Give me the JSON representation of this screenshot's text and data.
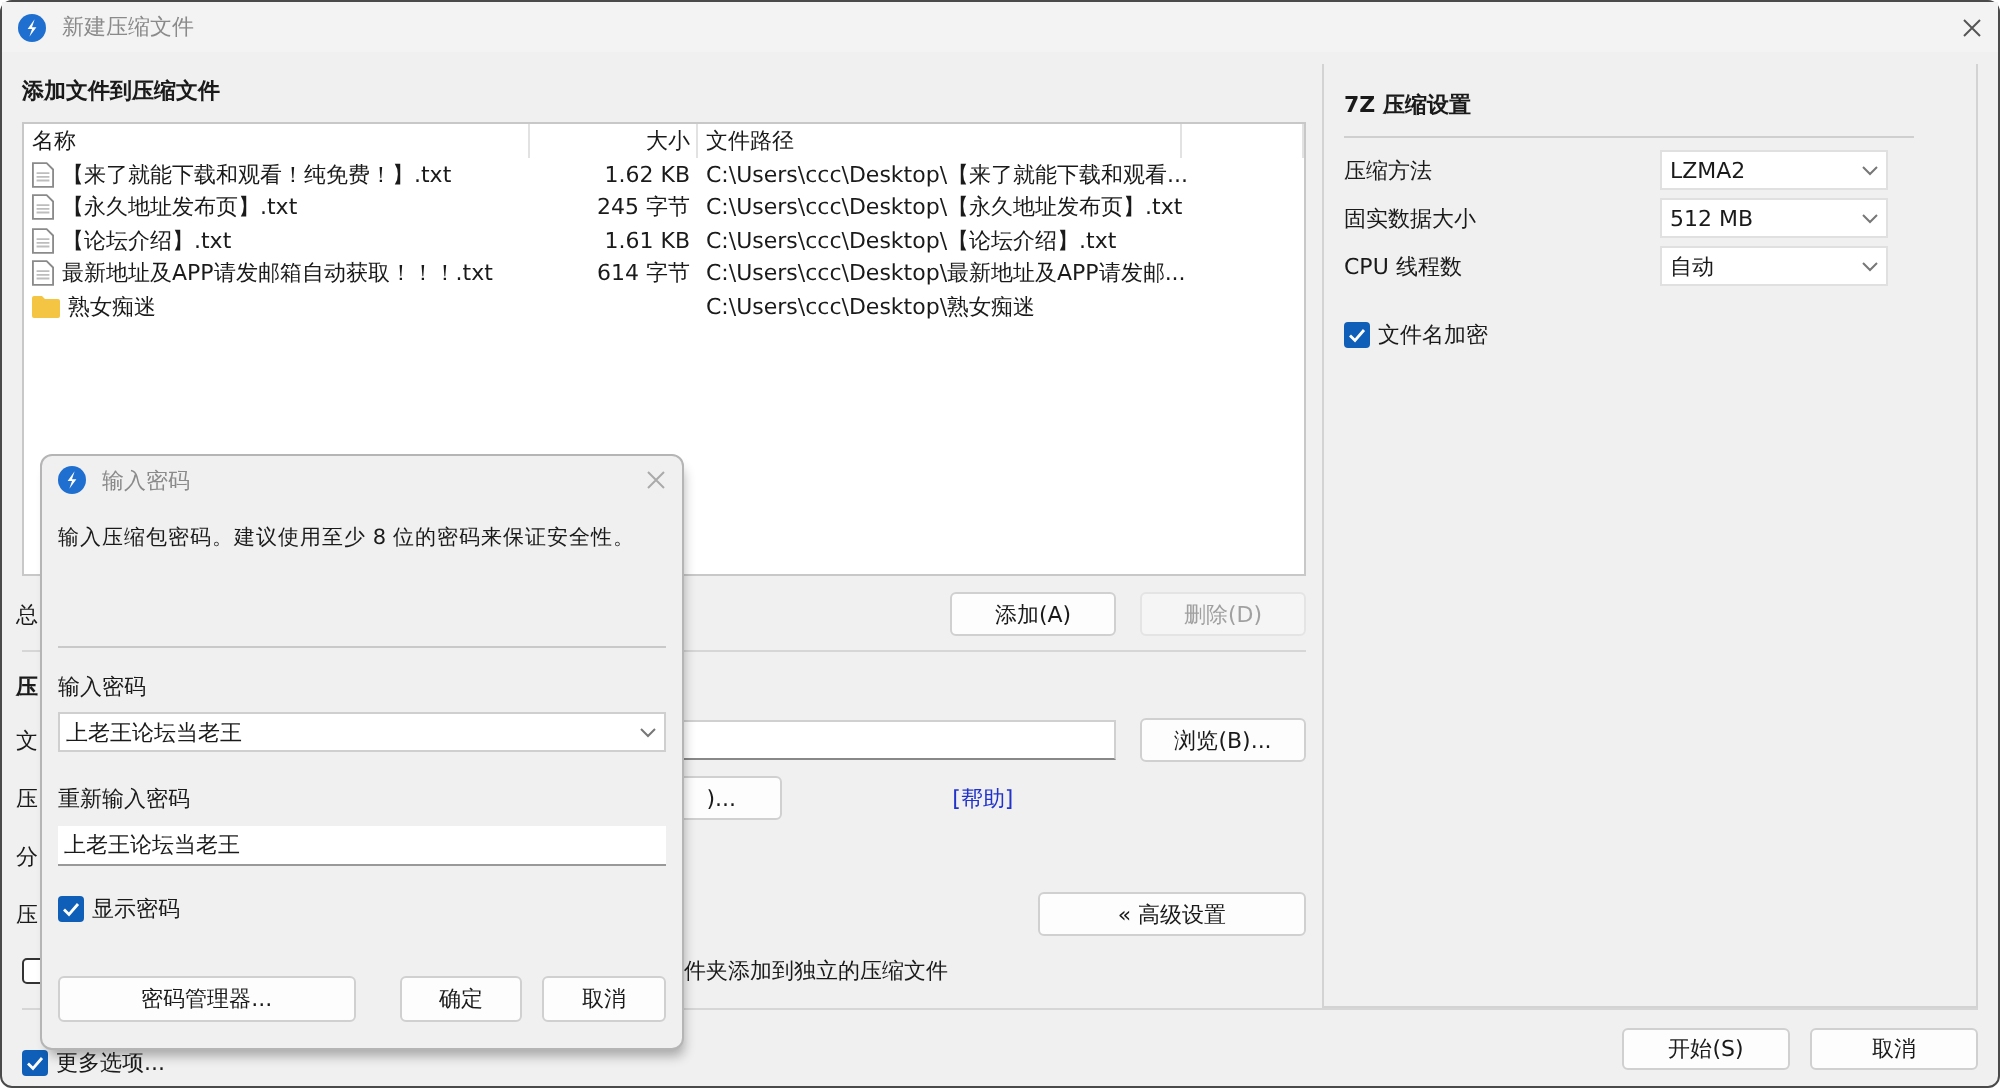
{
  "window": {
    "title": "新建压缩文件"
  },
  "files_section": {
    "heading": "添加文件到压缩文件",
    "columns": [
      "名称",
      "大小",
      "文件路径"
    ],
    "rows": [
      {
        "kind": "file",
        "name": "【来了就能下载和观看！纯免费！】.txt",
        "size": "1.62 KB",
        "path": "C:\\Users\\ccc\\Desktop\\【来了就能下载和观看..."
      },
      {
        "kind": "file",
        "name": "【永久地址发布页】.txt",
        "size": "245 字节",
        "path": "C:\\Users\\ccc\\Desktop\\【永久地址发布页】.txt"
      },
      {
        "kind": "file",
        "name": "【论坛介绍】.txt",
        "size": "1.61 KB",
        "path": "C:\\Users\\ccc\\Desktop\\【论坛介绍】.txt"
      },
      {
        "kind": "file",
        "name": "最新地址及APP请发邮箱自动获取！！！.txt",
        "size": "614 字节",
        "path": "C:\\Users\\ccc\\Desktop\\最新地址及APP请发邮..."
      },
      {
        "kind": "folder",
        "name": "熟女痴迷",
        "path": "C:\\Users\\ccc\\Desktop\\熟女痴迷"
      }
    ],
    "summary_label": "总",
    "buttons": [
      {
        "label": "添加(A)",
        "disabled": false
      },
      {
        "label": "删除(D)",
        "disabled": true
      }
    ]
  },
  "archive_section": {
    "heading": "压",
    "file_label": "文",
    "browse_button": "浏览(B)...",
    "format_label": "压",
    "password_button": ")...",
    "help_link": "[帮助]",
    "split_label": "分",
    "level_label": "压",
    "advanced_button": "« 高级设置",
    "separate_archives": {
      "label": "件夹添加到独立的压缩文件",
      "checked": false
    }
  },
  "more_options": {
    "label": "更多选项...",
    "checked": true
  },
  "settings": {
    "heading": "7Z 压缩设置",
    "fields": [
      {
        "label": "压缩方法",
        "value": "LZMA2"
      },
      {
        "label": "固实数据大小",
        "value": "512 MB"
      },
      {
        "label": "CPU 线程数",
        "value": "自动"
      }
    ],
    "encrypt_names": {
      "label": "文件名加密",
      "checked": true
    }
  },
  "buttons": [
    {
      "label": "开始(S)"
    },
    {
      "label": "取消"
    }
  ],
  "password_dialog": {
    "title": "输入密码",
    "message": "输入压缩包密码。建议使用至少 8 位的密码来保证安全性。",
    "password_label": "输入密码",
    "password": "上老王论坛当老王",
    "confirm_label": "重新输入密码",
    "confirm": "上老王论坛当老王",
    "show_password": {
      "label": "显示密码",
      "checked": true
    },
    "buttons": [
      {
        "label": "密码管理器..."
      },
      {
        "label": "确定"
      },
      {
        "label": "取消"
      }
    ]
  }
}
